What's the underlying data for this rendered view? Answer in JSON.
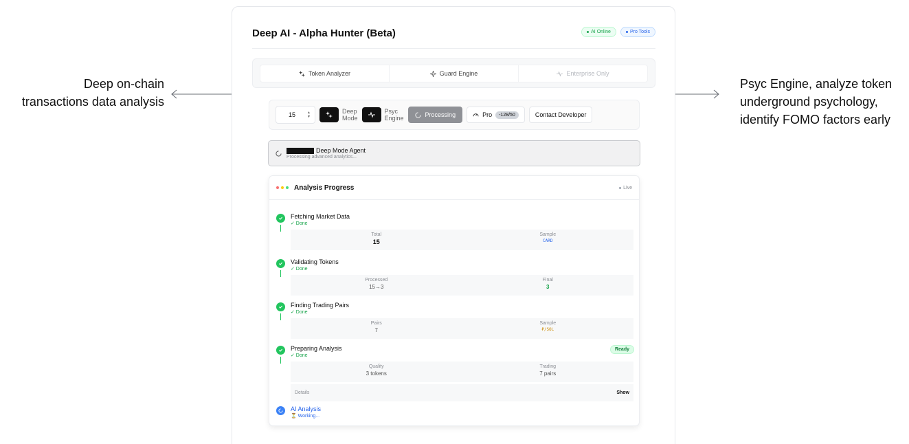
{
  "annotations": {
    "left_lines": [
      "Deep on-chain",
      "transactions data analysis"
    ],
    "right_lines": [
      "Psyc Engine, analyze token",
      "underground psychology,",
      "identify FOMO factors early"
    ]
  },
  "header": {
    "title": "Deep AI - Alpha Hunter (Beta)",
    "badge_online": "AI Online",
    "badge_pro": "Pro Tools"
  },
  "tabs": [
    {
      "label": "Token Analyzer",
      "icon": "sparkle-icon",
      "enabled": true
    },
    {
      "label": "Guard Engine",
      "icon": "sparkle-icon",
      "enabled": true
    },
    {
      "label": "Enterprise Only",
      "icon": "pulse-icon",
      "enabled": false
    }
  ],
  "toolbar": {
    "count_value": "15",
    "deep_mode_label_1": "Deep",
    "deep_mode_label_2": "Mode",
    "psyc_label_1": "Psyc",
    "psyc_label_2": "Engine",
    "processing_label": "Processing",
    "pro_label": "Pro",
    "pro_count": "-128/50",
    "contact_label": "Contact Developer"
  },
  "agent": {
    "title": "Deep Mode Agent",
    "subtitle": "Processing advanced analytics..."
  },
  "progress": {
    "title": "Analysis Progress",
    "live_label": "Live",
    "traffic_colors": [
      "#f87171",
      "#facc15",
      "#4ade80"
    ],
    "steps": [
      {
        "name": "Fetching Market Data",
        "status": "✓ Done",
        "metrics": [
          {
            "label": "Total",
            "value": "15"
          },
          {
            "label": "Sample",
            "value": "CARD"
          }
        ]
      },
      {
        "name": "Validating Tokens",
        "status": "✓ Done",
        "metrics": [
          {
            "label": "Processed",
            "value": "15→3"
          },
          {
            "label": "Final",
            "value": "3"
          }
        ]
      },
      {
        "name": "Finding Trading Pairs",
        "status": "✓ Done",
        "metrics": [
          {
            "label": "Pairs",
            "value": "7"
          },
          {
            "label": "Sample",
            "value": "₽/SOL"
          }
        ]
      },
      {
        "name": "Preparing Analysis",
        "status": "✓ Done",
        "badge": "Ready",
        "metrics": [
          {
            "label": "Quality",
            "value": "3 tokens"
          },
          {
            "label": "Trading",
            "value": "7 pairs"
          }
        ]
      }
    ],
    "details_label": "Details",
    "details_action": "Show",
    "ai_step": {
      "name": "AI Analysis",
      "status": "⏳ Working..."
    }
  }
}
